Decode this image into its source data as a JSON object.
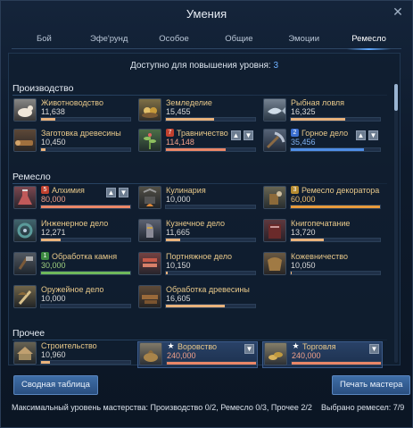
{
  "window": {
    "title": "Умения",
    "close_glyph": "✕"
  },
  "tabs": [
    {
      "label": "Бой"
    },
    {
      "label": "Эфе'рунд"
    },
    {
      "label": "Особое"
    },
    {
      "label": "Общие"
    },
    {
      "label": "Эмоции"
    },
    {
      "label": "Ремесло",
      "active": true
    }
  ],
  "available": {
    "text": "Доступно для повышения уровня:",
    "count": "3"
  },
  "sections": {
    "production": {
      "title": "Производство",
      "skills": [
        {
          "name": "Животноводство",
          "value": "11,638",
          "progress": 0.16,
          "color": "peach",
          "icon": "livestock-icon"
        },
        {
          "name": "Земледелие",
          "value": "15,455",
          "progress": 0.54,
          "color": "peach",
          "icon": "farming-icon"
        },
        {
          "name": "Рыбная ловля",
          "value": "16,325",
          "progress": 0.61,
          "color": "peach",
          "icon": "fishing-icon"
        },
        {
          "name": "Заготовка древесины",
          "value": "10,450",
          "progress": 0.05,
          "color": "peach",
          "icon": "logging-icon"
        },
        {
          "name": "Травничество",
          "value": "114,148",
          "progress": 0.67,
          "color": "salmon",
          "icon": "herbalism-icon",
          "badge": "7",
          "badge_color": "red",
          "arrows": true
        },
        {
          "name": "Горное дело",
          "value": "35,456",
          "progress": 0.82,
          "color": "blue",
          "icon": "mining-icon",
          "badge": "2",
          "badge_color": "blue",
          "arrows": true
        }
      ]
    },
    "craft": {
      "title": "Ремесло",
      "skills": [
        {
          "name": "Алхимия",
          "value": "80,000",
          "progress": 1.0,
          "color": "salmon",
          "icon": "alchemy-icon",
          "badge": "5",
          "badge_color": "red",
          "arrows": true
        },
        {
          "name": "Кулинария",
          "value": "10,000",
          "progress": 0.0,
          "color": "peach",
          "icon": "cooking-icon"
        },
        {
          "name": "Ремесло декоратора",
          "value": "60,000",
          "progress": 1.0,
          "color": "orange",
          "icon": "decorator-icon",
          "badge": "3",
          "badge_color": "gold"
        },
        {
          "name": "Инженерное дело",
          "value": "12,271",
          "progress": 0.22,
          "color": "peach",
          "icon": "engineering-icon"
        },
        {
          "name": "Кузнечное дело",
          "value": "11,665",
          "progress": 0.16,
          "color": "peach",
          "icon": "blacksmith-icon"
        },
        {
          "name": "Книгопечатание",
          "value": "13,720",
          "progress": 0.37,
          "color": "peach",
          "icon": "printing-icon"
        },
        {
          "name": "Обработка камня",
          "value": "30,000",
          "progress": 1.0,
          "color": "green",
          "icon": "masonry-icon",
          "badge": "1",
          "badge_color": "green"
        },
        {
          "name": "Портняжное дело",
          "value": "10,150",
          "progress": 0.02,
          "color": "peach",
          "icon": "tailoring-icon"
        },
        {
          "name": "Кожевничество",
          "value": "10,050",
          "progress": 0.01,
          "color": "peach",
          "icon": "leatherwork-icon"
        },
        {
          "name": "Оружейное дело",
          "value": "10,000",
          "progress": 0.0,
          "color": "peach",
          "icon": "weaponsmith-icon"
        },
        {
          "name": "Обработка древесины",
          "value": "16,605",
          "progress": 0.66,
          "color": "peach",
          "icon": "carpentry-icon"
        }
      ]
    },
    "other": {
      "title": "Прочее",
      "skills": [
        {
          "name": "Строительство",
          "value": "10,960",
          "progress": 0.1,
          "color": "peach",
          "icon": "construction-icon"
        },
        {
          "name": "Воровство",
          "value": "240,000",
          "progress": 1.0,
          "color": "salmon",
          "icon": "thievery-icon",
          "badge": "★",
          "badge_color": "star",
          "down_arrow": true,
          "highlight": true
        },
        {
          "name": "Торговля",
          "value": "240,000",
          "progress": 1.0,
          "color": "salmon",
          "icon": "trade-icon",
          "badge": "★",
          "badge_color": "star",
          "down_arrow": true,
          "highlight": true
        }
      ]
    }
  },
  "arrows": {
    "up": "▲",
    "down": "▼"
  },
  "buttons": {
    "summary": "Сводная таблица",
    "print": "Печать мастера"
  },
  "footer": {
    "mastery": "Максимальный уровень мастерства: Производство 0/2, Ремесло 0/3, Прочее 2/2",
    "selected": "Выбрано ремесел: 7/9"
  },
  "colors": {
    "peach": "#e8b27c",
    "salmon": "#ea8768",
    "blue": "#4f8ee6",
    "green": "#6fb85b",
    "orange": "#e79a3c"
  }
}
